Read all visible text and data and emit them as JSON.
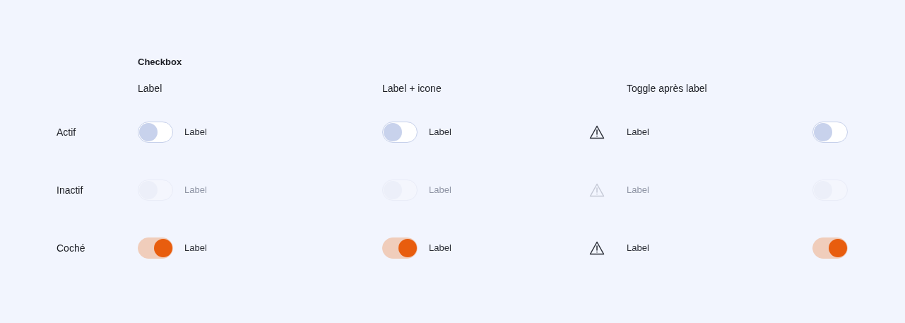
{
  "section_title": "Checkbox",
  "columns": [
    {
      "title": "Label",
      "kind": "plain"
    },
    {
      "title": "Label + icone",
      "kind": "icon"
    },
    {
      "title": "Toggle après label",
      "kind": "trailing"
    }
  ],
  "rows": [
    {
      "label": "Actif",
      "disabled": false,
      "checked": false,
      "cells": [
        {
          "label": "Label"
        },
        {
          "label": "Label"
        },
        {
          "label": "Label"
        }
      ]
    },
    {
      "label": "Inactif",
      "disabled": true,
      "checked": false,
      "cells": [
        {
          "label": "Label"
        },
        {
          "label": "Label"
        },
        {
          "label": "Label"
        }
      ]
    },
    {
      "label": "Coché",
      "disabled": false,
      "checked": true,
      "cells": [
        {
          "label": "Label"
        },
        {
          "label": "Label"
        },
        {
          "label": "Label"
        }
      ]
    }
  ]
}
